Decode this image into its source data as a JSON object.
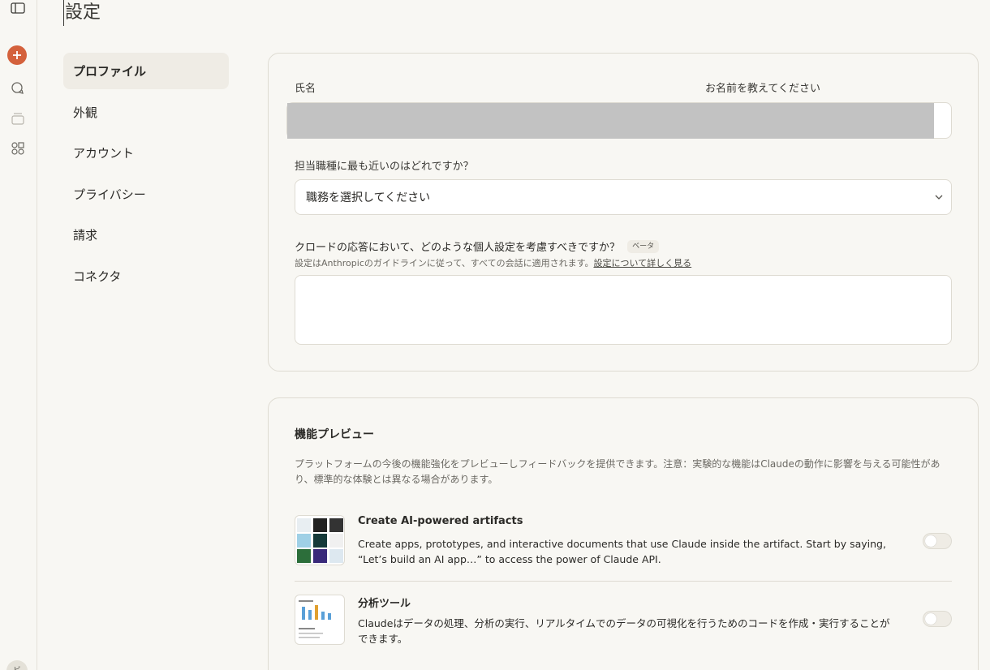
{
  "page": {
    "title": "設定"
  },
  "rail": {
    "icons": [
      "sidebar-toggle-icon",
      "plus-icon",
      "chat-bubbles-icon",
      "archive-icon",
      "apps-icon"
    ],
    "avatar_initial": "ビ",
    "accent": "#d4613c"
  },
  "nav": {
    "items": [
      {
        "label": "プロファイル",
        "active": true
      },
      {
        "label": "外観"
      },
      {
        "label": "アカウント"
      },
      {
        "label": "プライバシー"
      },
      {
        "label": "請求"
      },
      {
        "label": "コネクタ"
      }
    ]
  },
  "profile": {
    "name_label": "氏名",
    "name_hint": "お名前を教えてください",
    "role_label": "担当職種に最も近いのはどれですか？",
    "role_select_value": "職務を選択してください",
    "pref_label": "クロードの応答において、どのような個人設定を考慮すべきですか？",
    "beta_badge": "ベータ",
    "pref_help": "設定はAnthropicのガイドラインに従って、すべての会話に適用されます。",
    "pref_help_link": "設定について詳しく見る",
    "pref_value": ""
  },
  "features": {
    "title": "機能プレビュー",
    "description": "プラットフォームの今後の機能強化をプレビューしフィードバックを提供できます。注意：実験的な機能はClaudeの動作に影響を与える可能性があり、標準的な体験とは異なる場合があります。",
    "items": [
      {
        "title": "Create AI-powered artifacts",
        "description": "Create apps, prototypes, and interactive documents that use Claude inside the artifact. Start by saying, “Let’s build an AI app…” to access the power of Claude API.",
        "enabled": false
      },
      {
        "title": "分析ツール",
        "description": "Claudeはデータの処理、分析の実行、リアルタイムでのデータの可視化を行うためのコードを作成・実行することができます。",
        "enabled": false
      }
    ]
  }
}
